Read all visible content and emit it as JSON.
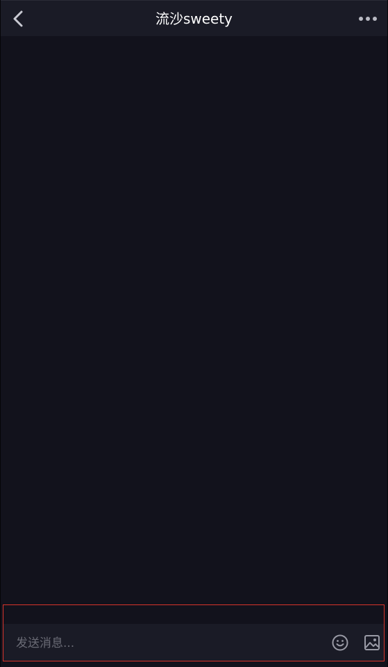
{
  "header": {
    "title": "流沙sweety",
    "back_icon": "chevron-left-icon",
    "more_icon": "more-horizontal-icon"
  },
  "input_bar": {
    "placeholder": "发送消息...",
    "value": "",
    "emoji_icon": "smiley-icon",
    "image_icon": "image-icon",
    "highlight_color": "#d9342b"
  },
  "colors": {
    "background": "#12121c",
    "header_background": "#1a1b26",
    "icon_color": "#9a9ba6"
  }
}
